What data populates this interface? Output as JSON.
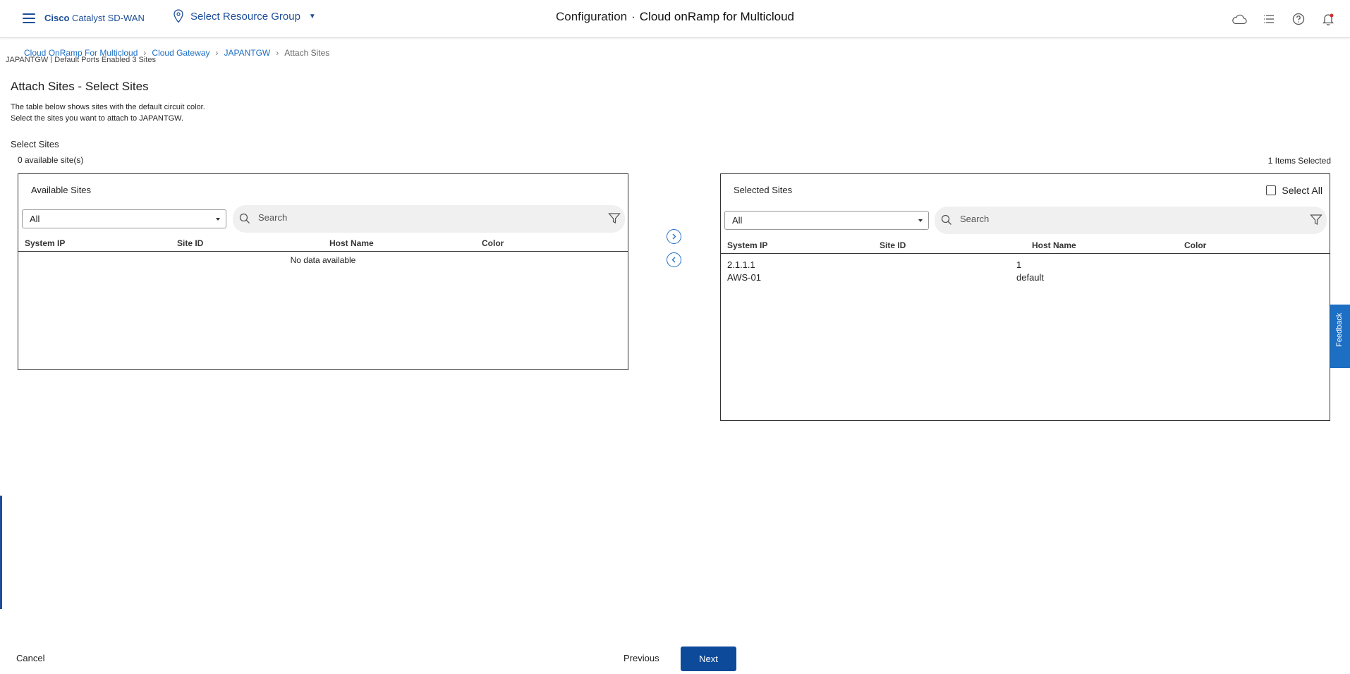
{
  "header": {
    "brand_prefix": "Cisco",
    "brand_suffix": "Catalyst SD-WAN",
    "resource_group": "Select Resource Group",
    "title_part1": "Configuration",
    "title_sep": "·",
    "title_part2": "Cloud onRamp for Multicloud",
    "icons": [
      "cloud-icon",
      "list-icon",
      "help-icon",
      "bell-icon"
    ]
  },
  "breadcrumb": {
    "items": [
      "Cloud OnRamp For Multicloud",
      "Cloud Gateway",
      "JAPANTGW"
    ],
    "current": "Attach Sites"
  },
  "ghost_row": "JAPANTGW     |   Default        Ports          Enabled              3 Sites",
  "main": {
    "title": "Attach Sites - Select Sites",
    "desc_line1": "The table below shows sites with the default circuit color.",
    "desc_line2": "Select the sites you want to attach to JAPANTGW.",
    "select_sites_label": "Select Sites",
    "available_count": "0 available site(s)",
    "items_selected": "1 Items Selected"
  },
  "available": {
    "title": "Available Sites",
    "filter_value": "All",
    "search_placeholder": "Search",
    "columns": [
      "System IP",
      "Site ID",
      "Host Name",
      "Color"
    ],
    "empty_text": "No data available"
  },
  "selected": {
    "title": "Selected Sites",
    "select_all_label": "Select All",
    "filter_value": "All",
    "search_placeholder": "Search",
    "columns": [
      "System IP",
      "Site ID",
      "Host Name",
      "Color"
    ],
    "rows": [
      {
        "system_ip": "2.1.1.1",
        "system_ip_line2": "AWS-01",
        "host_line1": "1",
        "host_line2": "default"
      }
    ]
  },
  "feedback_label": "Feedback",
  "footer": {
    "cancel": "Cancel",
    "previous": "Previous",
    "next": "Next"
  },
  "colors": {
    "brand": "#1d4e9a",
    "link": "#1d6fc4",
    "primary_button": "#0d4a9a"
  }
}
